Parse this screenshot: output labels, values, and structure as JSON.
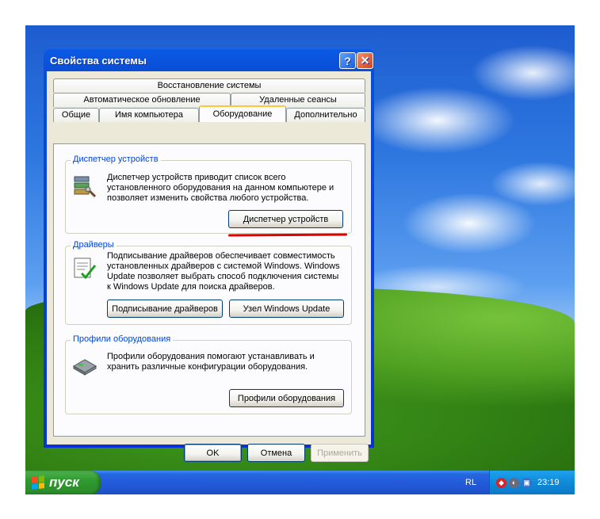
{
  "desktop": {
    "recycle_bin_icon": "recycle-bin-icon"
  },
  "window": {
    "title": "Свойства системы",
    "help_symbol": "?",
    "close_symbol": "✕",
    "tabs": {
      "row1": [
        "Восстановление системы"
      ],
      "row2": [
        "Автоматическое обновление",
        "Удаленные сеансы"
      ],
      "row3": [
        "Общие",
        "Имя компьютера",
        "Оборудование",
        "Дополнительно"
      ]
    },
    "active_tab": "Оборудование",
    "device_manager": {
      "legend": "Диспетчер устройств",
      "text_lines": [
        "Диспетчер устройств приводит список всего",
        "установленного оборудования на данном компьютере и",
        "позволяет изменить свойства любого устройства."
      ],
      "button": "Диспетчер устройств"
    },
    "drivers": {
      "legend": "Драйверы",
      "text_lines": [
        "Подписывание драйверов обеспечивает совместимость",
        "установленных драйверов с системой Windows.  Windows",
        "Update позволяет выбрать способ подключения системы",
        "к Windows Update для поиска драйверов."
      ],
      "signing_button": "Подписывание драйверов",
      "update_button": "Узел Windows Update"
    },
    "profiles": {
      "legend": "Профили оборудования",
      "text_lines": [
        "Профили оборудования помогают устанавливать и",
        "хранить различные конфигурации оборудования."
      ],
      "button": "Профили оборудования"
    },
    "ok_button": "OK",
    "cancel_button": "Отмена",
    "apply_button": "Применить",
    "annotation_color": "#e00000"
  },
  "taskbar": {
    "start_label": "пуск",
    "language": "RL",
    "clock": "23:19"
  }
}
